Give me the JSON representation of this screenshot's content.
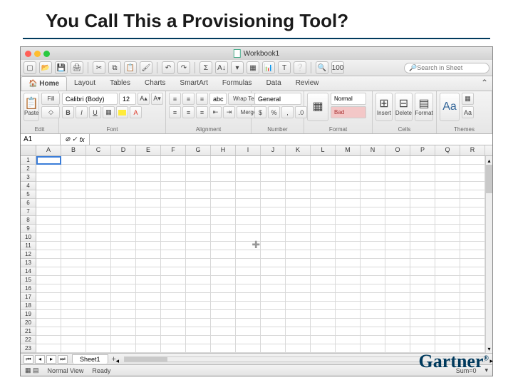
{
  "slide": {
    "title": "You Call This a Provisioning Tool?"
  },
  "brand": "Gartner",
  "window": {
    "title": "Workbook1"
  },
  "search": {
    "placeholder": "Search in Sheet"
  },
  "tabs": [
    "Home",
    "Layout",
    "Tables",
    "Charts",
    "SmartArt",
    "Formulas",
    "Data",
    "Review"
  ],
  "groups": {
    "edit": "Edit",
    "font": "Font",
    "alignment": "Alignment",
    "number": "Number",
    "format": "Format",
    "cells": "Cells",
    "themes": "Themes"
  },
  "font": {
    "family": "Calibri (Body)",
    "size": "12",
    "fill": "Fill",
    "paste": "Paste"
  },
  "alignment": {
    "wrap": "Wrap Text",
    "abc": "abc"
  },
  "number": {
    "format": "General",
    "percent": "%"
  },
  "format": {
    "normal": "Normal",
    "bad": "Bad",
    "cond": "Conditional Formatting"
  },
  "cells": {
    "insert": "Insert",
    "delete": "Delete",
    "format_btn": "Format"
  },
  "themes": {
    "label": "Themes",
    "aa": "Aa"
  },
  "namebox": "A1",
  "fx": "fx",
  "columns": [
    "A",
    "B",
    "C",
    "D",
    "E",
    "F",
    "G",
    "H",
    "I",
    "J",
    "K",
    "L",
    "M",
    "N",
    "O",
    "P",
    "Q",
    "R"
  ],
  "rows": [
    "1",
    "2",
    "3",
    "4",
    "5",
    "6",
    "7",
    "8",
    "9",
    "10",
    "11",
    "12",
    "13",
    "14",
    "15",
    "16",
    "17",
    "18",
    "19",
    "20",
    "21",
    "22",
    "23"
  ],
  "sheet_tab": "Sheet1",
  "status": {
    "view": "Normal View",
    "ready": "Ready",
    "sum": "Sum=0"
  }
}
